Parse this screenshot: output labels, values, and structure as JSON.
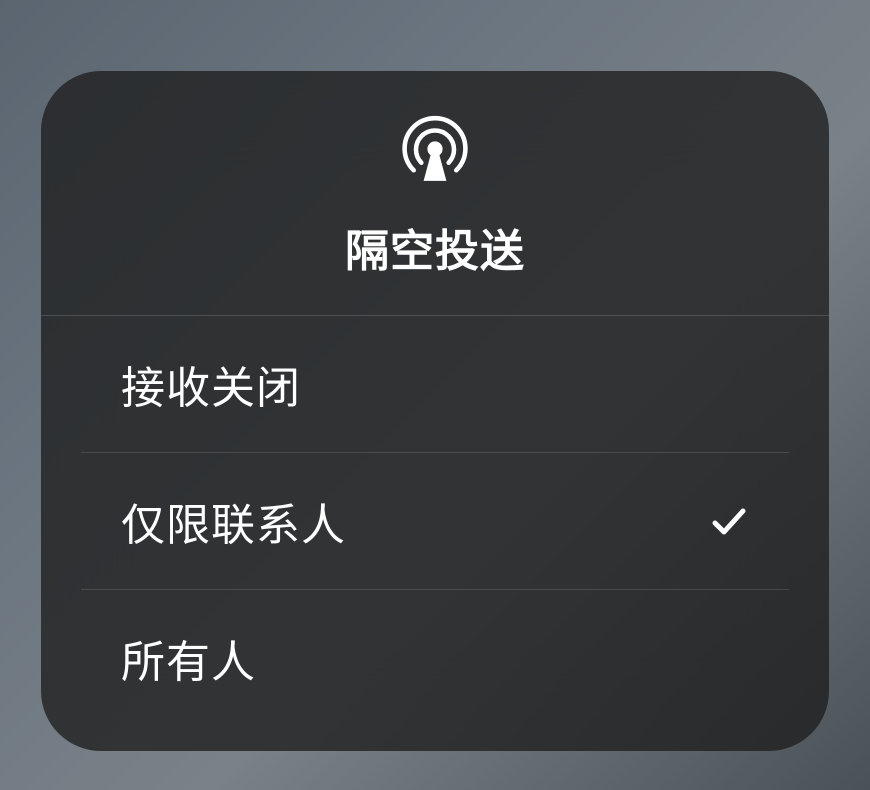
{
  "header": {
    "icon_name": "airdrop-icon",
    "title": "隔空投送"
  },
  "options": [
    {
      "label": "接收关闭",
      "selected": false
    },
    {
      "label": "仅限联系人",
      "selected": true
    },
    {
      "label": "所有人",
      "selected": false
    }
  ]
}
